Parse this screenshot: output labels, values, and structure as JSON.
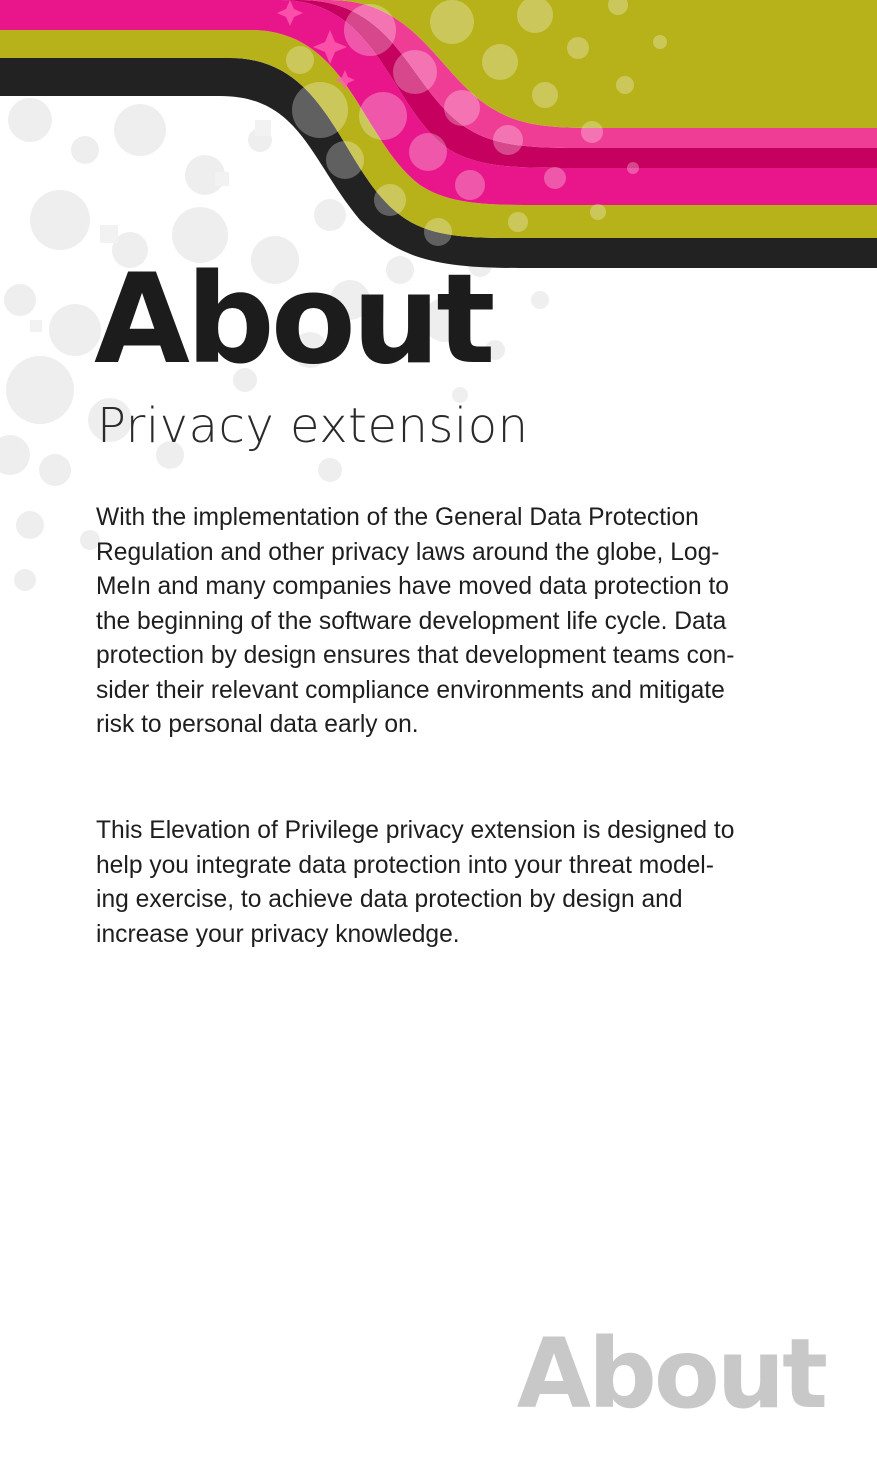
{
  "card": {
    "title": "About",
    "subtitle": "Privacy extension",
    "paragraphs": [
      "With the implementation of the General Data Protection\nRegulation and other privacy laws around the globe, Log-\nMeIn and many companies have moved data protection to\nthe beginning of the software development life cycle.  Data\nprotection by design ensures that development teams con-\nsider their relevant compliance environments and mitigate\nrisk to personal data early on.",
      "This Elevation of Privilege privacy extension is designed to\nhelp you integrate data protection into your threat model-\ning exercise, to achieve data protection by design and\nincrease your privacy knowledge."
    ],
    "footer_label": "About"
  },
  "colors": {
    "stripe_dark": "#222222",
    "stripe_olive": "#b8b21a",
    "stripe_pink": "#e8168a",
    "stripe_magenta_light": "#ef5aa8",
    "title_text": "#1c1c1c",
    "footer_text": "#c8c8c8",
    "dots": "#e8e8e8"
  }
}
